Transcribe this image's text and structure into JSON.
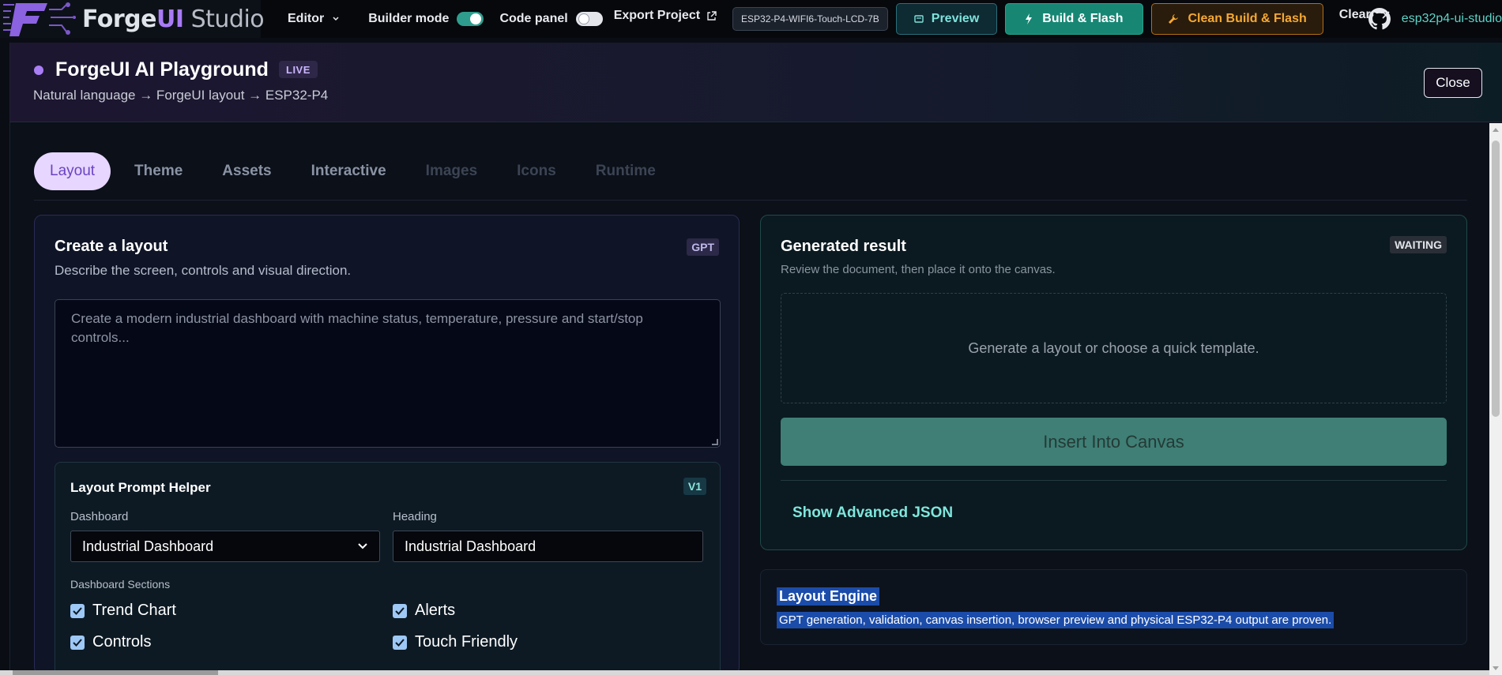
{
  "topbar": {
    "brand": {
      "forge": "Forge",
      "ui": "UI",
      "studio": " Studio"
    },
    "editor_label": "Editor",
    "builder_mode_label": "Builder mode",
    "code_panel_label": "Code panel",
    "export_label": "Export Project",
    "device": "ESP32-P4-WIFI6-Touch-LCD-7B",
    "preview_label": "Preview",
    "build_label": "Build & Flash",
    "clean_label": "Clean Build & Flash",
    "clear_label": "Clear",
    "repo_name": "esp32p4-ui-studio",
    "builder_mode_on": true,
    "code_panel_on": false
  },
  "modal": {
    "title": "ForgeUI AI Playground",
    "badge": "LIVE",
    "subtitle": "Natural language → ForgeUI layout → ESP32-P4",
    "close_label": "Close",
    "tabs": [
      {
        "label": "Layout",
        "state": "active"
      },
      {
        "label": "Theme",
        "state": "normal"
      },
      {
        "label": "Assets",
        "state": "normal"
      },
      {
        "label": "Interactive",
        "state": "normal"
      },
      {
        "label": "Images",
        "state": "disabled"
      },
      {
        "label": "Icons",
        "state": "disabled"
      },
      {
        "label": "Runtime",
        "state": "disabled"
      }
    ]
  },
  "create": {
    "title": "Create a layout",
    "tag": "GPT",
    "desc": "Describe the screen, controls and visual direction.",
    "placeholder": "Create a modern industrial dashboard with machine status, temperature, pressure and start/stop controls..."
  },
  "helper": {
    "title": "Layout Prompt Helper",
    "tag": "V1",
    "dashboard_label": "Dashboard",
    "dashboard_value": "Industrial Dashboard",
    "heading_label": "Heading",
    "heading_value": "Industrial Dashboard",
    "sections_label": "Dashboard Sections",
    "sections": [
      {
        "label": "Trend Chart",
        "checked": true
      },
      {
        "label": "Alerts",
        "checked": true
      },
      {
        "label": "Controls",
        "checked": true
      },
      {
        "label": "Touch Friendly",
        "checked": true
      }
    ]
  },
  "result": {
    "title": "Generated result",
    "tag": "WAITING",
    "sub": "Review the document, then place it onto the canvas.",
    "empty": "Generate a layout or choose a quick template.",
    "insert_label": "Insert Into Canvas",
    "advanced_label": "Show Advanced JSON"
  },
  "engine": {
    "title": "Layout Engine",
    "desc": "GPT generation, validation, canvas insertion, browser preview and physical ESP32-P4 output are proven."
  },
  "colors": {
    "accent_purple": "#a87bf5",
    "accent_teal": "#178774",
    "accent_orange": "#f5a934",
    "selection_blue": "#1b4caa"
  }
}
